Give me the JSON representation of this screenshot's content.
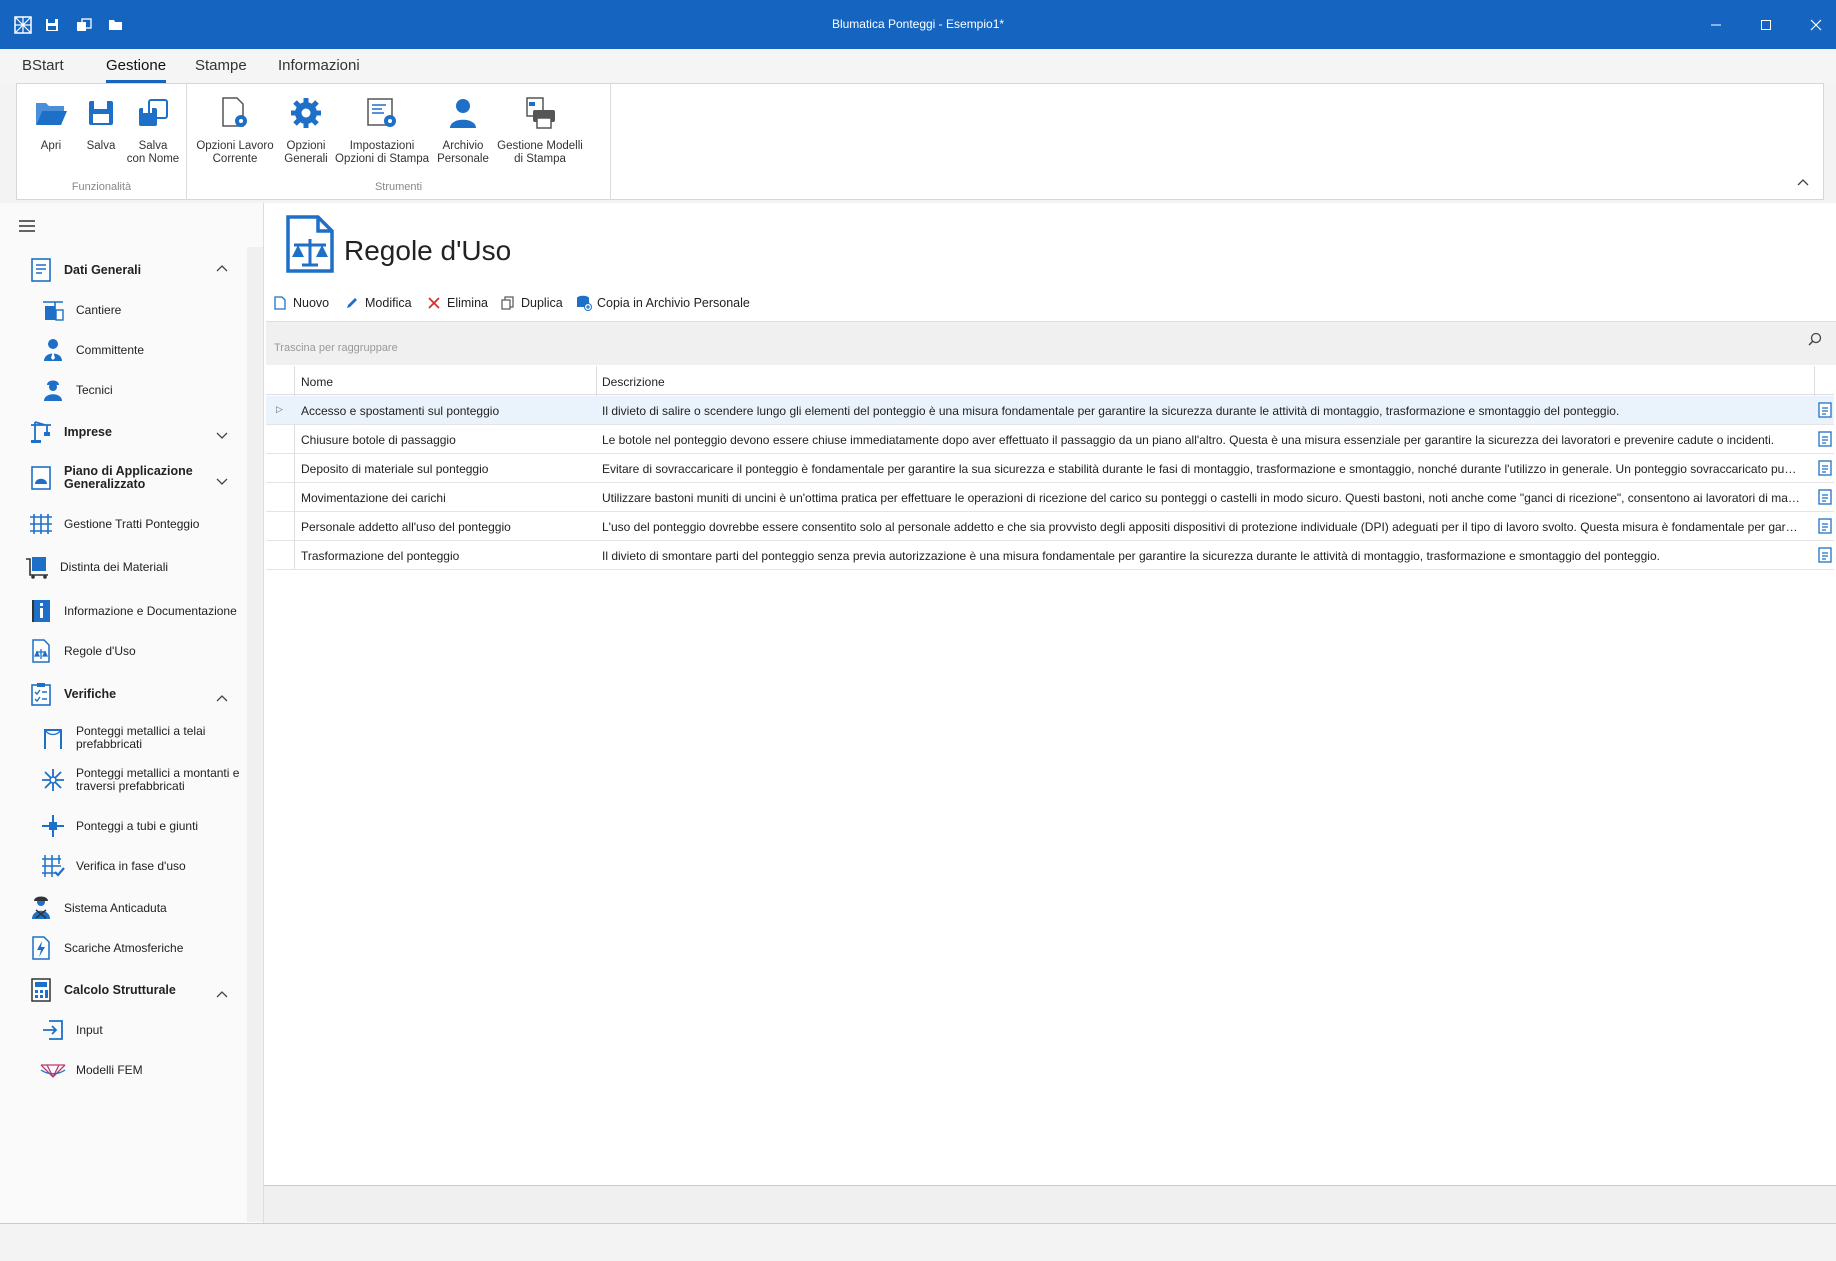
{
  "window": {
    "title": "Blumatica Ponteggi - Esempio1*"
  },
  "tabs": [
    "BStart",
    "Gestione",
    "Stampe",
    "Informazioni"
  ],
  "ribbon": {
    "group1": {
      "label": "Funzionalità",
      "buttons": [
        {
          "l1": "Apri",
          "l2": ""
        },
        {
          "l1": "Salva",
          "l2": ""
        },
        {
          "l1": "Salva",
          "l2": "con Nome"
        }
      ]
    },
    "group2": {
      "label": "Strumenti",
      "buttons": [
        {
          "l1": "Opzioni Lavoro",
          "l2": "Corrente"
        },
        {
          "l1": "Opzioni",
          "l2": "Generali"
        },
        {
          "l1": "Impostazioni",
          "l2": "Opzioni di Stampa"
        },
        {
          "l1": "Archivio",
          "l2": "Personale"
        },
        {
          "l1": "Gestione Modelli",
          "l2": "di Stampa"
        }
      ]
    }
  },
  "sidebar": {
    "items": [
      {
        "l1": "Dati Generali",
        "l2": ""
      },
      {
        "l1": "Cantiere",
        "l2": ""
      },
      {
        "l1": "Committente",
        "l2": ""
      },
      {
        "l1": "Tecnici",
        "l2": ""
      },
      {
        "l1": "Imprese",
        "l2": ""
      },
      {
        "l1": "Piano di Applicazione",
        "l2": "Generalizzato"
      },
      {
        "l1": "Gestione Tratti Ponteggio",
        "l2": ""
      },
      {
        "l1": "Distinta dei Materiali",
        "l2": ""
      },
      {
        "l1": "Informazione e Documentazione",
        "l2": ""
      },
      {
        "l1": "Regole d'Uso",
        "l2": ""
      },
      {
        "l1": "Verifiche",
        "l2": ""
      },
      {
        "l1": "Ponteggi metallici a telai",
        "l2": "prefabbricati"
      },
      {
        "l1": "Ponteggi metallici a montanti e",
        "l2": "traversi prefabbricati"
      },
      {
        "l1": "Ponteggi a tubi e giunti",
        "l2": ""
      },
      {
        "l1": "Verifica in fase d'uso",
        "l2": ""
      },
      {
        "l1": "Sistema Anticaduta",
        "l2": ""
      },
      {
        "l1": "Scariche Atmosferiche",
        "l2": ""
      },
      {
        "l1": "Calcolo Strutturale",
        "l2": ""
      },
      {
        "l1": "Input",
        "l2": ""
      },
      {
        "l1": "Modelli FEM",
        "l2": ""
      }
    ]
  },
  "main": {
    "title": "Regole d'Uso",
    "toolbar": [
      "Nuovo",
      "Modifica",
      "Elimina",
      "Duplica",
      "Copia in Archivio Personale"
    ],
    "group_placeholder": "Trascina per raggruppare",
    "columns": [
      "Nome",
      "Descrizione"
    ],
    "rows": [
      {
        "nome": "Accesso e spostamenti sul ponteggio",
        "descrizione": "Il divieto di salire o scendere lungo gli elementi del ponteggio è una misura fondamentale per garantire la sicurezza durante le attività di montaggio, trasformazione e smontaggio del ponteggio."
      },
      {
        "nome": "Chiusure botole di passaggio",
        "descrizione": "Le botole nel ponteggio devono essere chiuse immediatamente dopo aver effettuato il passaggio da un piano all'altro. Questa è una misura essenziale per garantire la sicurezza dei lavoratori e prevenire cadute o incidenti."
      },
      {
        "nome": "Deposito di materiale sul ponteggio",
        "descrizione": "Evitare di sovraccaricare il ponteggio è fondamentale per garantire la sua sicurezza e stabilità durante le fasi di montaggio, trasformazione e smontaggio, nonché durante l'utilizzo in generale. Un ponteggio sovraccaricato può diventare instabile e aum..."
      },
      {
        "nome": "Movimentazione dei carichi",
        "descrizione": "Utilizzare bastoni muniti di uncini è un'ottima pratica per effettuare le operazioni di ricezione del carico su ponteggi o castelli in modo sicuro. Questi bastoni, noti anche come \"ganci di ricezione\", consentono ai lavoratori di maneggiare materiali e attrezz..."
      },
      {
        "nome": "Personale addetto all'uso del ponteggio",
        "descrizione": "L'uso del ponteggio dovrebbe essere consentito solo al personale addetto e che sia provvisto degli appositi dispositivi di protezione individuale (DPI) adeguati per il tipo di lavoro svolto. Questa misura è fondamentale per garantire la sicurezza dei lavor..."
      },
      {
        "nome": "Trasformazione del ponteggio",
        "descrizione": "Il divieto di smontare parti del ponteggio senza previa autorizzazione è una misura fondamentale per garantire la sicurezza durante le attività di montaggio, trasformazione e smontaggio del ponteggio."
      }
    ]
  },
  "colors": {
    "accent": "#1565c0",
    "icon_blue": "#1e6fc8",
    "selected_row": "#eaf3fc"
  }
}
